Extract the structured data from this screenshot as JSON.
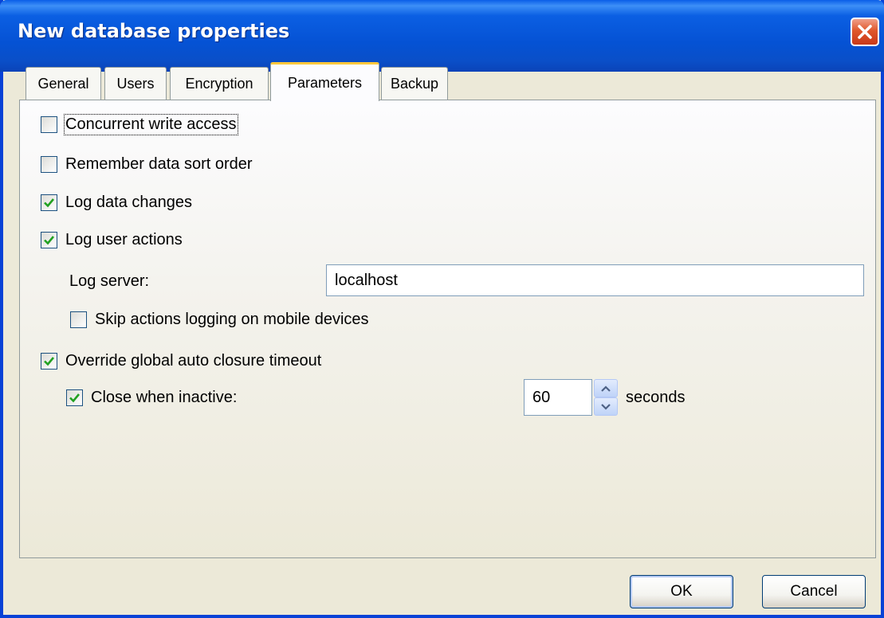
{
  "window": {
    "title": "New database properties",
    "close_icon": "close-icon"
  },
  "tabs": [
    {
      "label": "General",
      "active": false
    },
    {
      "label": "Users",
      "active": false
    },
    {
      "label": "Encryption",
      "active": false
    },
    {
      "label": "Parameters",
      "active": true
    },
    {
      "label": "Backup",
      "active": false
    }
  ],
  "parameters": {
    "concurrent_write": {
      "label": "Concurrent write access",
      "checked": false
    },
    "remember_sort": {
      "label": "Remember data sort order",
      "checked": false
    },
    "log_data_changes": {
      "label": "Log data changes",
      "checked": true
    },
    "log_user_actions": {
      "label": "Log user actions",
      "checked": true
    },
    "log_server": {
      "label": "Log server:",
      "value": "localhost"
    },
    "skip_mobile": {
      "label": "Skip actions logging on mobile devices",
      "checked": false
    },
    "override_timeout": {
      "label": "Override global auto closure timeout",
      "checked": true
    },
    "close_inactive": {
      "label": "Close when inactive:",
      "checked": true,
      "value": "60",
      "unit": "seconds"
    }
  },
  "buttons": {
    "ok": "OK",
    "cancel": "Cancel"
  },
  "colors": {
    "titlebar": "#0552d4",
    "check": "#21a121",
    "focus_tab": "#ffc83c"
  }
}
